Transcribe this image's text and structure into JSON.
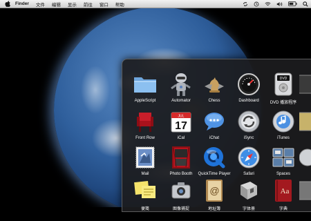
{
  "menubar": {
    "app_name": "Finder",
    "items": [
      "文件",
      "编辑",
      "显示",
      "前往",
      "窗口",
      "帮助"
    ]
  },
  "stack": {
    "apps": [
      {
        "label": "AppleScript",
        "icon": "folder-icon"
      },
      {
        "label": "Automator",
        "icon": "automator-robot-icon"
      },
      {
        "label": "Chess",
        "icon": "chess-knight-icon"
      },
      {
        "label": "Dashboard",
        "icon": "dashboard-gauge-icon"
      },
      {
        "label": "DVD 播放程序",
        "icon": "dvd-player-icon"
      },
      {
        "label": "Front Row",
        "icon": "front-row-chair-icon"
      },
      {
        "label": "iCal",
        "icon": "ical-calendar-icon"
      },
      {
        "label": "iChat",
        "icon": "ichat-bubble-icon"
      },
      {
        "label": "iSync",
        "icon": "isync-icon"
      },
      {
        "label": "iTunes",
        "icon": "itunes-icon"
      },
      {
        "label": "Mail",
        "icon": "mail-stamp-icon"
      },
      {
        "label": "Photo Booth",
        "icon": "photo-booth-icon"
      },
      {
        "label": "QuickTime Player",
        "icon": "quicktime-icon"
      },
      {
        "label": "Safari",
        "icon": "safari-compass-icon"
      },
      {
        "label": "Spaces",
        "icon": "spaces-icon"
      },
      {
        "label": "便笺",
        "icon": "stickies-icon"
      },
      {
        "label": "图像捕捉",
        "icon": "image-capture-icon"
      },
      {
        "label": "地址簿",
        "icon": "address-book-icon"
      },
      {
        "label": "字体册",
        "icon": "font-book-icon"
      },
      {
        "label": "字典",
        "icon": "dictionary-icon"
      }
    ],
    "ical_day": "17",
    "ical_month": "JUL",
    "dictionary_glyph": "Aa",
    "address_book_glyph": "@"
  },
  "colors": {
    "menubar": "#dcdcdc",
    "stack_bg": "#1c1c1e",
    "folder": "#7fb3e8"
  }
}
